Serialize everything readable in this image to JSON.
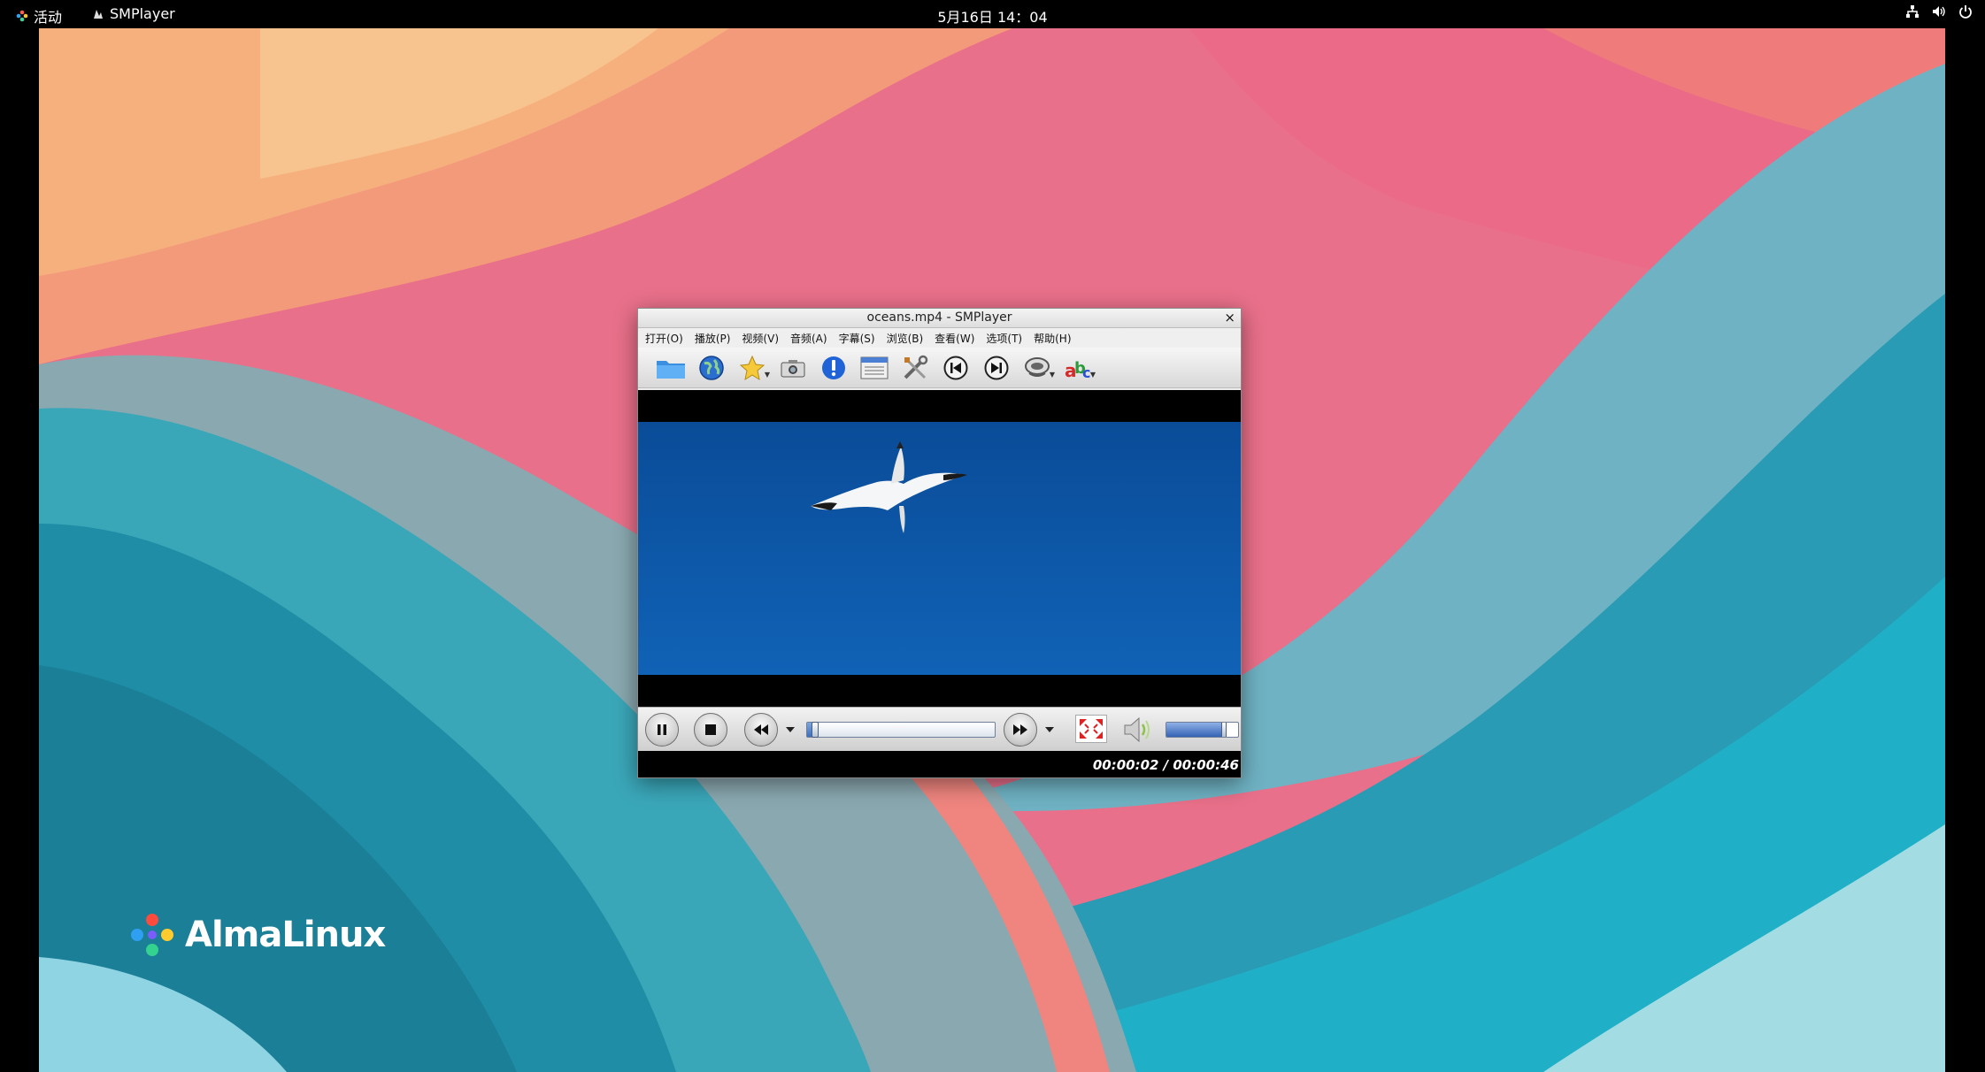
{
  "topbar": {
    "activities_label": "活动",
    "app_label": "SMPlayer",
    "clock": "5月16日  14：04",
    "icons": [
      "network-icon",
      "volume-icon",
      "power-icon"
    ]
  },
  "desktop": {
    "logo_text": "AlmaLinux"
  },
  "window": {
    "title": "oceans.mp4 - SMPlayer",
    "close_glyph": "×",
    "menu": [
      "打开(O)",
      "播放(P)",
      "视频(V)",
      "音频(A)",
      "字幕(S)",
      "浏览(B)",
      "查看(W)",
      "选项(T)",
      "帮助(H)"
    ],
    "toolbar_icons": [
      "open-folder-icon",
      "open-url-icon",
      "favorites-icon",
      "screenshot-icon",
      "info-icon",
      "playlist-icon",
      "preferences-icon",
      "previous-icon",
      "next-icon",
      "audio-track-icon",
      "subtitle-icon"
    ],
    "status_time": "00:00:02 / 00:00:46",
    "seek_fraction": 0.04,
    "volume_fraction": 0.78
  },
  "colors": {
    "accent": "#3c6fbf",
    "video_blue": "#0b5aab"
  }
}
